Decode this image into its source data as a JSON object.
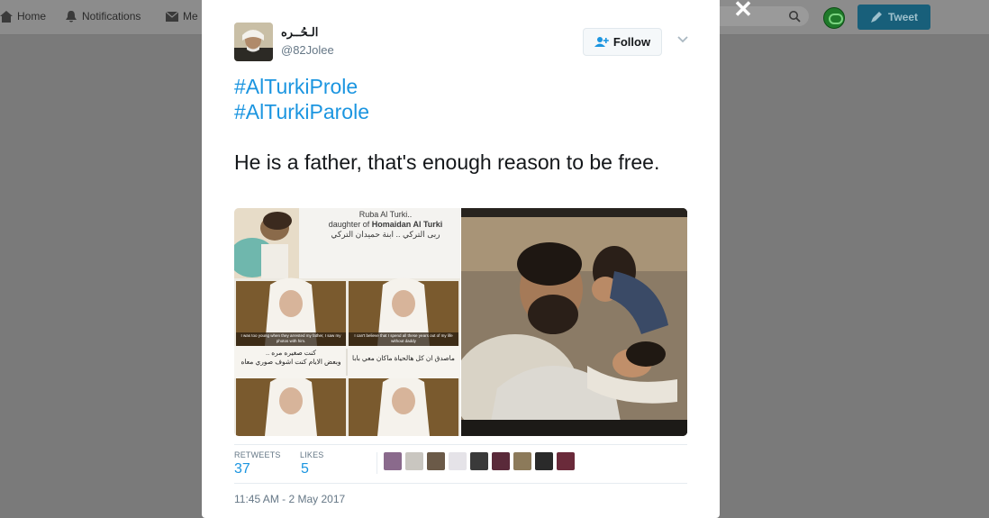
{
  "topnav": {
    "home": "Home",
    "notifications": "Notifications",
    "messages": "Me",
    "tweet_button": "Tweet"
  },
  "tweet": {
    "author_name": "الـحُــره",
    "author_handle": "@82Jolee",
    "follow_label": "Follow",
    "hashtags": [
      "#AlTurkiProle",
      "#AlTurkiParole"
    ],
    "body": "He is a father, that's enough reason to be free.",
    "media": {
      "collage": {
        "title_line1": "Ruba Al Turki..",
        "title_line2_prefix": "daughter of ",
        "title_line2_name": "Homaidan Al Turki",
        "title_arabic": "ربى التركي .. ابنة حميدان التركي",
        "caption_left": "I was too young when they arrested my father, I saw my photos with him.",
        "caption_right": "I can't believe that I spend all these years out of my life without daddy",
        "arabic_left_1": "كنت صغيره مره ..",
        "arabic_left_2": "وبعض الايام كنت اشوف صوري معاه",
        "arabic_right": "ماصدق ان كل هالحياة ماكان معي بابا"
      }
    },
    "stats": {
      "retweets_label": "RETWEETS",
      "retweets_count": "37",
      "likes_label": "LIKES",
      "likes_count": "5"
    },
    "liker_colors": [
      "#8a6a8c",
      "#c9c6c0",
      "#6b5a48",
      "#e5e3e8",
      "#3a3a3a",
      "#5a2a3a",
      "#8c7a5a",
      "#2a2a2a",
      "#6a2a3a"
    ],
    "timestamp": "11:45 AM - 2 May 2017"
  },
  "colors": {
    "link": "#1b95e0",
    "tweet_button_bg": "#185f7a"
  }
}
